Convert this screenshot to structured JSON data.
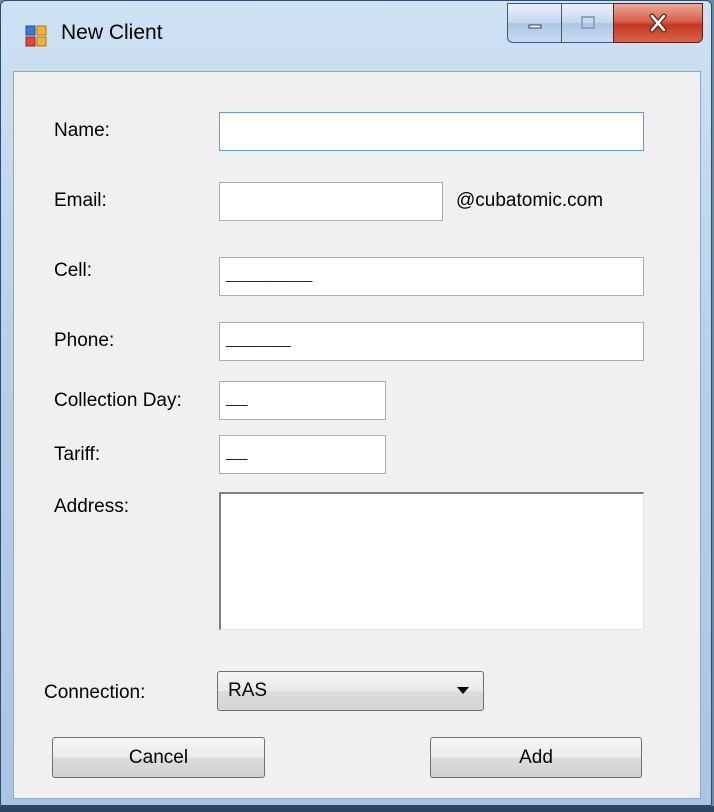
{
  "window": {
    "title": "New Client",
    "app_icon": "form-icon",
    "caption_buttons": [
      "minimize-icon",
      "maximize-icon",
      "close-icon"
    ]
  },
  "form": {
    "name_label": "Name:",
    "name_value": "",
    "email_label": "Email:",
    "email_value": "",
    "email_suffix": "@cubatomic.com",
    "cell_label": "Cell:",
    "cell_mask": "________",
    "phone_label": "Phone:",
    "phone_mask": "______",
    "collection_day_label": "Collection Day:",
    "collection_day_mask": "__",
    "tariff_label": "Tariff:",
    "tariff_mask": "__",
    "address_label": "Address:",
    "address_value": "",
    "connection_label": "Connection:",
    "connection_value": "RAS"
  },
  "buttons": {
    "cancel": "Cancel",
    "add": "Add"
  },
  "colors": {
    "focus_border": "#569de5",
    "close_button": "#c5371f",
    "form_background": "#f0f0f0"
  }
}
